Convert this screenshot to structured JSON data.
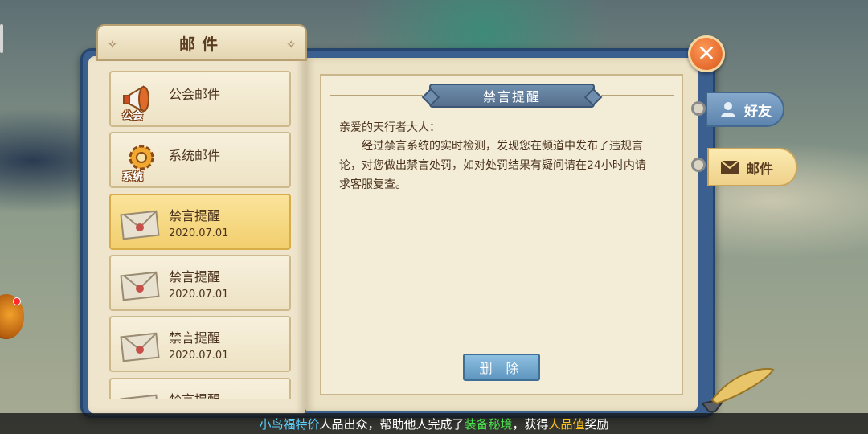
{
  "header": {
    "title": "邮件"
  },
  "mail_list": [
    {
      "type": "guild",
      "title": "公会邮件",
      "date": "",
      "icon": "megaphone-icon",
      "icon_tag": "公会",
      "selected": false
    },
    {
      "type": "system",
      "title": "系统邮件",
      "date": "",
      "icon": "gear-icon",
      "icon_tag": "系统",
      "selected": false
    },
    {
      "type": "letter",
      "title": "禁言提醒",
      "date": "2020.07.01",
      "icon": "envelope-icon",
      "icon_tag": "",
      "selected": true
    },
    {
      "type": "letter",
      "title": "禁言提醒",
      "date": "2020.07.01",
      "icon": "envelope-icon",
      "icon_tag": "",
      "selected": false
    },
    {
      "type": "letter",
      "title": "禁言提醒",
      "date": "2020.07.01",
      "icon": "envelope-icon",
      "icon_tag": "",
      "selected": false
    },
    {
      "type": "letter",
      "title": "禁言提醒",
      "date": "",
      "icon": "envelope-icon",
      "icon_tag": "",
      "selected": false
    }
  ],
  "detail": {
    "title": "禁言提醒",
    "greeting": "亲爱的天行者大人：",
    "body": "经过禁言系统的实时检测，发现您在频道中发布了违规言论，对您做出禁言处罚，如对处罚结果有疑问请在24小时内请求客服复查。",
    "delete_label": "删 除"
  },
  "close": {
    "icon": "close-icon",
    "label": "✕"
  },
  "side_tabs": [
    {
      "label": "好友",
      "icon": "person-icon",
      "active": false
    },
    {
      "label": "邮件",
      "icon": "envelope-icon",
      "active": true
    }
  ],
  "ticker": {
    "segments": [
      {
        "text": "小鸟福特价",
        "color": "blue"
      },
      {
        "text": "人品出众，帮助他人完成了",
        "color": "white"
      },
      {
        "text": "装备秘境",
        "color": "green"
      },
      {
        "text": "，获得",
        "color": "white"
      },
      {
        "text": "人品值",
        "color": "yellow"
      },
      {
        "text": "奖励",
        "color": "white"
      }
    ]
  },
  "colors": {
    "book_cover": "#3b5f8f",
    "selected_item": "#f2cf6e",
    "banner": "#556f8c",
    "close_button": "#d9561c",
    "ticker_blue": "#5bd0ff",
    "ticker_green": "#49e04c",
    "ticker_yellow": "#ffc21a"
  }
}
